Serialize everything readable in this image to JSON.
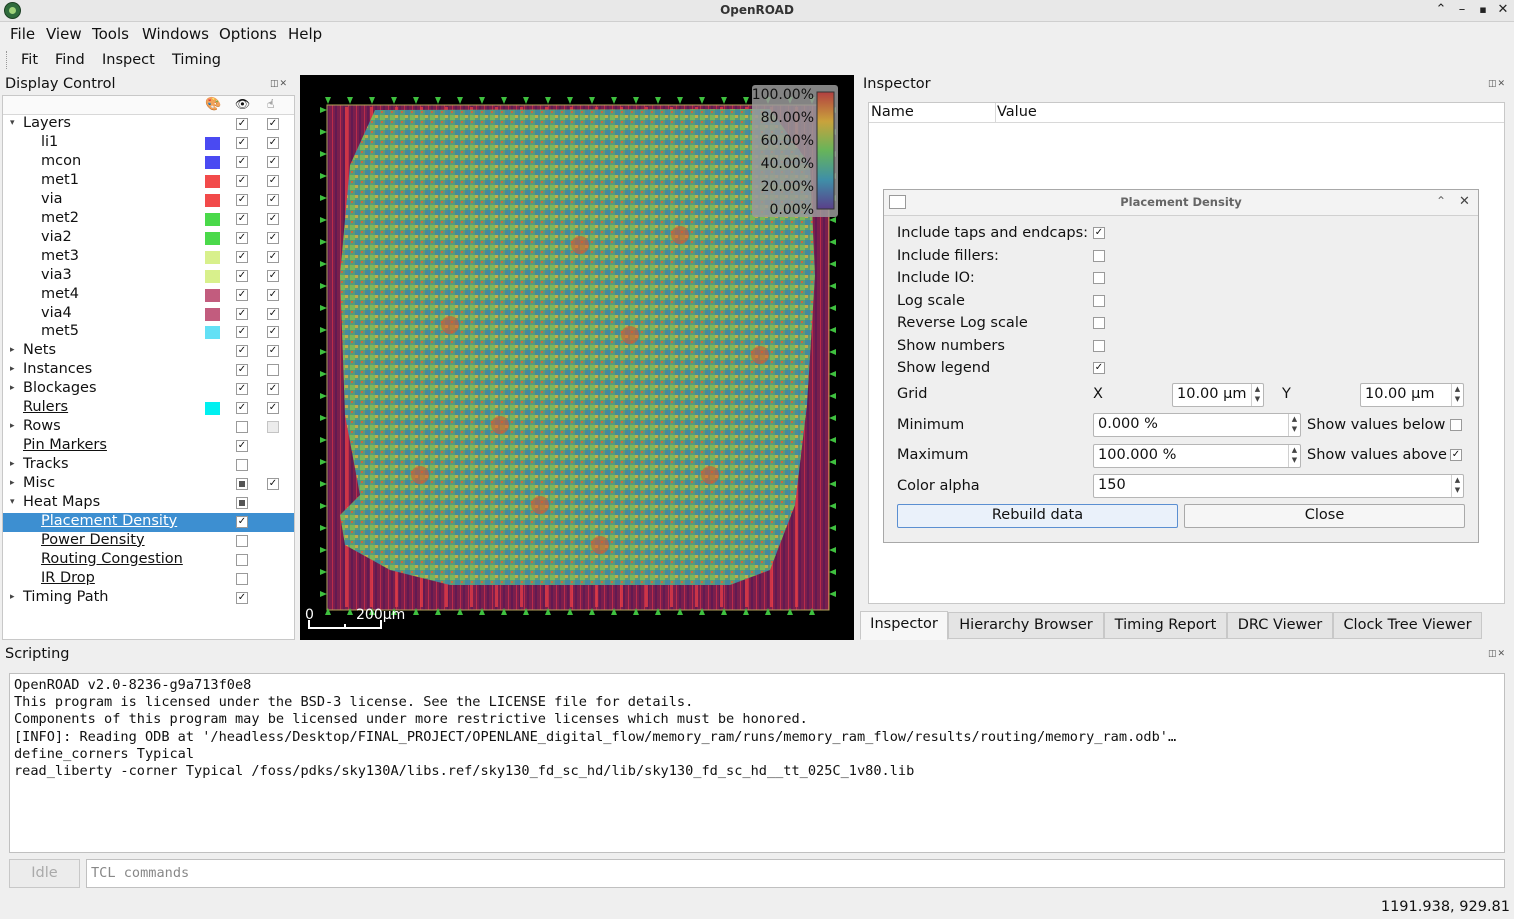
{
  "window": {
    "title": "OpenROAD"
  },
  "menubar": [
    "File",
    "View",
    "Tools",
    "Windows",
    "Options",
    "Help"
  ],
  "toolbar": [
    "Fit",
    "Find",
    "Inspect",
    "Timing"
  ],
  "display_control": {
    "title": "Display Control",
    "rows": [
      {
        "label": "Layers",
        "arrow": "open",
        "visible": true,
        "selectable": true
      },
      {
        "label": "li1",
        "color": "#4a4af2",
        "visible": true,
        "selectable": true
      },
      {
        "label": "mcon",
        "color": "#4a4af2",
        "visible": true,
        "selectable": true
      },
      {
        "label": "met1",
        "color": "#f24a4a",
        "visible": true,
        "selectable": true
      },
      {
        "label": "via",
        "color": "#f24a4a",
        "visible": true,
        "selectable": true
      },
      {
        "label": "met2",
        "color": "#4ad94a",
        "visible": true,
        "selectable": true
      },
      {
        "label": "via2",
        "color": "#4ad94a",
        "visible": true,
        "selectable": true
      },
      {
        "label": "met3",
        "color": "#d8f08c",
        "visible": true,
        "selectable": true
      },
      {
        "label": "via3",
        "color": "#d8f08c",
        "visible": true,
        "selectable": true
      },
      {
        "label": "met4",
        "color": "#c25c7e",
        "visible": true,
        "selectable": true
      },
      {
        "label": "via4",
        "color": "#c25c7e",
        "visible": true,
        "selectable": true
      },
      {
        "label": "met5",
        "color": "#63e0f5",
        "visible": true,
        "selectable": true
      },
      {
        "label": "Nets",
        "arrow": "closed",
        "visible": true,
        "selectable": true
      },
      {
        "label": "Instances",
        "arrow": "closed",
        "visible": true,
        "selectable": false
      },
      {
        "label": "Blockages",
        "arrow": "closed",
        "visible": true,
        "selectable": true
      },
      {
        "label": "Rulers",
        "color": "#00f0f0",
        "visible": true,
        "selectable": true
      },
      {
        "label": "Rows",
        "arrow": "closed",
        "visible": false,
        "selectable": "disabled"
      },
      {
        "label": "Pin Markers",
        "visible": true
      },
      {
        "label": "Tracks",
        "arrow": "closed",
        "visible": false
      },
      {
        "label": "Misc",
        "arrow": "closed",
        "visible": "partial",
        "selectable": true
      },
      {
        "label": "Heat Maps",
        "arrow": "open",
        "visible": "partial"
      },
      {
        "label": "Placement Density",
        "visible": true
      },
      {
        "label": "Power Density",
        "visible": false
      },
      {
        "label": "Routing Congestion",
        "visible": false
      },
      {
        "label": "IR Drop",
        "visible": false
      },
      {
        "label": "Timing Path",
        "arrow": "closed",
        "visible": true
      }
    ]
  },
  "legend": {
    "labels": [
      "100.00%",
      "80.00%",
      "60.00%",
      "40.00%",
      "20.00%",
      "0.00%"
    ]
  },
  "scale_bar": {
    "start": "0",
    "end": "200µm"
  },
  "inspector": {
    "title": "Inspector",
    "columns": [
      "Name",
      "Value"
    ],
    "tabs": [
      "Inspector",
      "Hierarchy Browser",
      "Timing Report",
      "DRC Viewer",
      "Clock Tree Viewer"
    ]
  },
  "placement_density": {
    "title": "Placement Density",
    "options": [
      {
        "label": "Include taps and endcaps:",
        "checked": true
      },
      {
        "label": "Include fillers:",
        "checked": false
      },
      {
        "label": "Include IO:",
        "checked": false
      },
      {
        "label": "Log scale",
        "checked": false
      },
      {
        "label": "Reverse Log scale",
        "checked": false
      },
      {
        "label": "Show numbers",
        "checked": false
      },
      {
        "label": "Show legend",
        "checked": true
      }
    ],
    "grid": {
      "label": "Grid",
      "x_label": "X",
      "x_value": "10.00 µm",
      "y_label": "Y",
      "y_value": "10.00 µm"
    },
    "minimum": {
      "label": "Minimum",
      "value": "0.000 %",
      "extra": "Show values below",
      "checked": false
    },
    "maximum": {
      "label": "Maximum",
      "value": "100.000 %",
      "extra": "Show values above",
      "checked": true
    },
    "alpha": {
      "label": "Color alpha",
      "value": "150"
    },
    "rebuild": "Rebuild data",
    "close": "Close"
  },
  "scripting": {
    "title": "Scripting",
    "lines": [
      "OpenROAD v2.0-8236-g9a713f0e8",
      "This program is licensed under the BSD-3 license. See the LICENSE file for details.",
      "Components of this program may be licensed under more restrictive licenses which must be honored.",
      "[INFO]: Reading ODB at '/headless/Desktop/FINAL_PROJECT/OPENLANE_digital_flow/memory_ram/runs/memory_ram_flow/results/routing/memory_ram.odb'…",
      "define_corners Typical",
      "read_liberty -corner Typical /foss/pdks/sky130A/libs.ref/sky130_fd_sc_hd/lib/sky130_fd_sc_hd__tt_025C_1v80.lib"
    ],
    "status": "Idle",
    "placeholder": "TCL commands"
  },
  "status_bar": {
    "coords": "1191.938, 929.81"
  }
}
